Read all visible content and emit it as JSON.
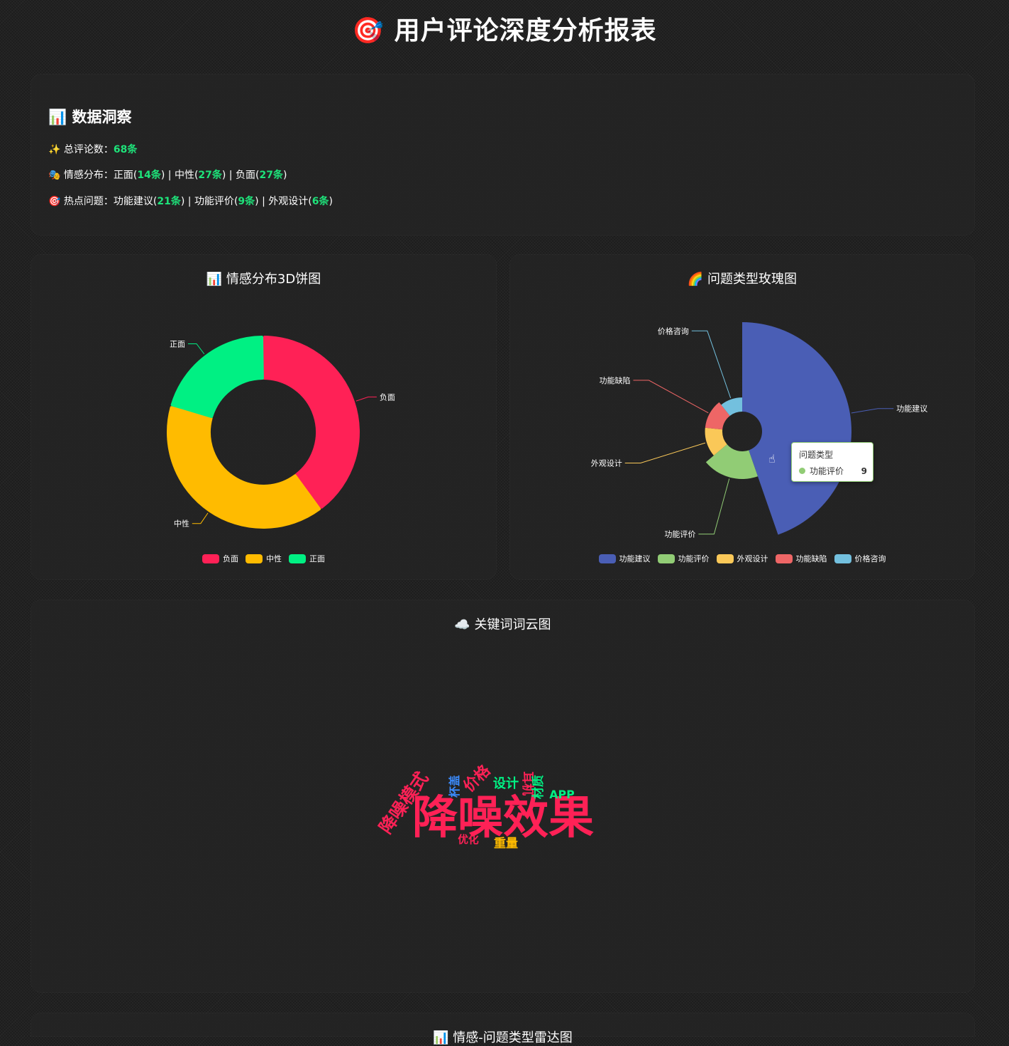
{
  "header": {
    "icon": "🎯",
    "title": "用户评论深度分析报表"
  },
  "insights": {
    "title_icon": "📊",
    "title": "数据洞察",
    "total": {
      "icon": "✨",
      "label": "总评论数：",
      "value": "68条"
    },
    "sentiment": {
      "icon": "🎭",
      "label": "情感分布：",
      "items": [
        {
          "name": "正面",
          "count": "14条"
        },
        {
          "name": "中性",
          "count": "27条"
        },
        {
          "name": "负面",
          "count": "27条"
        }
      ]
    },
    "hot": {
      "icon": "🎯",
      "label": "热点问题：",
      "items": [
        {
          "name": "功能建议",
          "count": "21条"
        },
        {
          "name": "功能评价",
          "count": "9条"
        },
        {
          "name": "外观设计",
          "count": "6条"
        }
      ]
    }
  },
  "sentiment_card": {
    "title": "📊 情感分布3D饼图"
  },
  "rose_card": {
    "title": "🌈 问题类型玫瑰图"
  },
  "cloud_card": {
    "title": "☁️ 关键词词云图"
  },
  "radar_card": {
    "title": "📊 情感-问题类型雷达图"
  },
  "tooltip": {
    "title": "问题类型",
    "name": "功能评价",
    "value": "9",
    "color": "#91cc75"
  },
  "chart_data": [
    {
      "type": "pie",
      "title": "情感分布3D饼图",
      "categories": [
        "负面",
        "中性",
        "正面"
      ],
      "values": [
        27,
        27,
        14
      ],
      "colors": [
        "#ff2156",
        "#ffbb00",
        "#00f083"
      ],
      "legend": "bottom"
    },
    {
      "type": "pie",
      "subtype": "rose",
      "title": "问题类型玫瑰图",
      "categories": [
        "功能建议",
        "功能评价",
        "外观设计",
        "功能缺陷",
        "价格咨询"
      ],
      "values": [
        21,
        9,
        6,
        6,
        5
      ],
      "colors": [
        "#4a5eb5",
        "#91cc75",
        "#fac858",
        "#ee6666",
        "#73c0de"
      ],
      "legend": "bottom"
    },
    {
      "type": "wordcloud",
      "title": "关键词词云图",
      "words": [
        {
          "text": "降噪效果",
          "weight": 100,
          "color": "#ff2156"
        },
        {
          "text": "降噪模式",
          "weight": 30,
          "color": "#ff2156"
        },
        {
          "text": "价格",
          "weight": 24,
          "color": "#ff2156"
        },
        {
          "text": "设计",
          "weight": 18,
          "color": "#00f083"
        },
        {
          "text": "耳机",
          "weight": 16,
          "color": "#ff2156"
        },
        {
          "text": "材质",
          "weight": 16,
          "color": "#00f083"
        },
        {
          "text": "APP",
          "weight": 14,
          "color": "#00f083"
        },
        {
          "text": "杯盖",
          "weight": 14,
          "color": "#3b8cff"
        },
        {
          "text": "重量",
          "weight": 16,
          "color": "#ffbb00"
        },
        {
          "text": "优化",
          "weight": 12,
          "color": "#ff2156"
        }
      ]
    }
  ]
}
